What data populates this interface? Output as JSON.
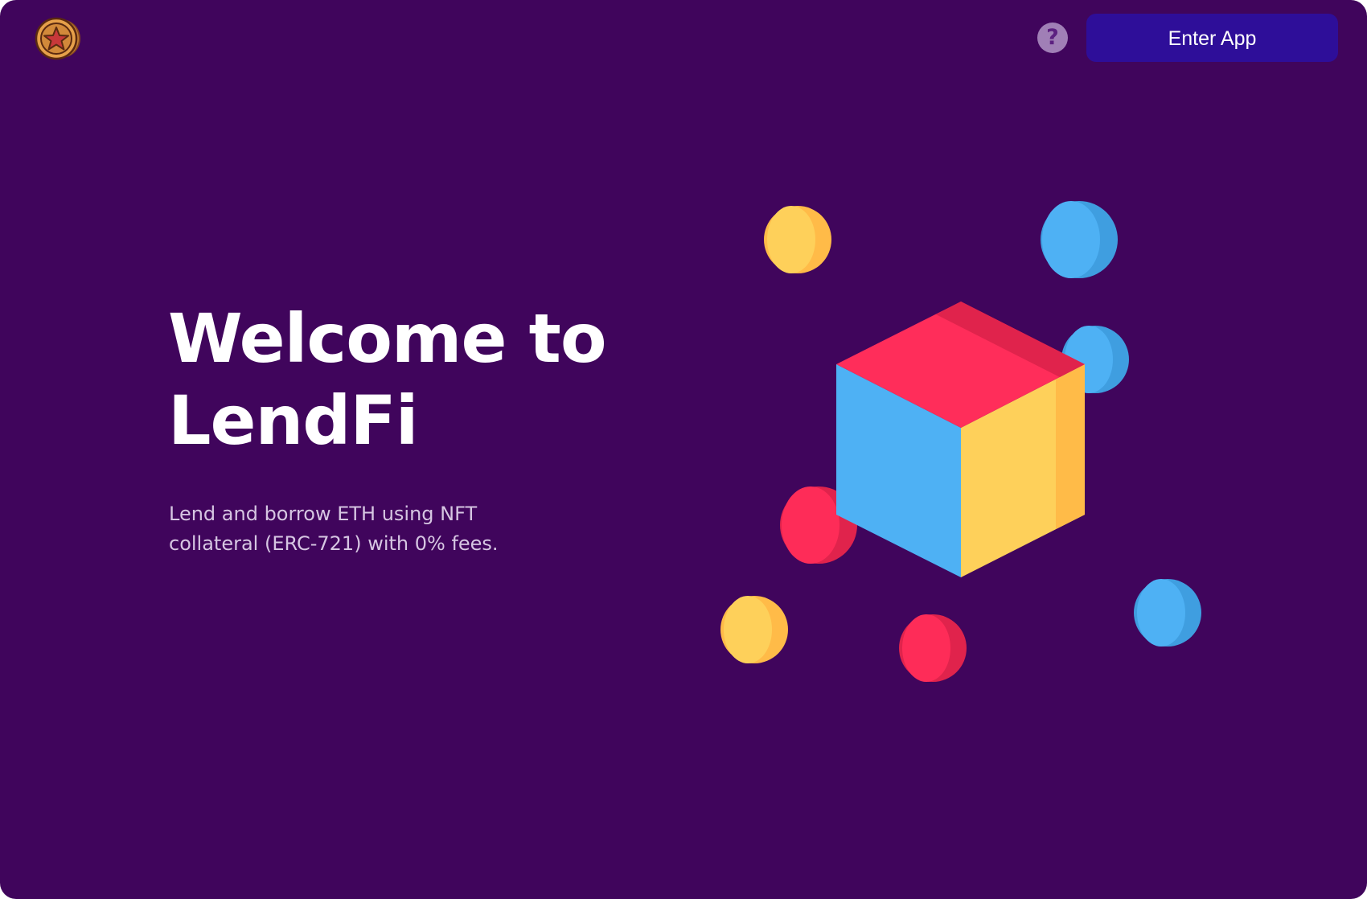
{
  "header": {
    "logo_icon": "star-coin-icon",
    "help_icon": "question-mark-icon",
    "help_glyph": "?",
    "enter_button_label": "Enter App"
  },
  "hero": {
    "title": "Welcome to LendFi",
    "subtitle": "Lend and borrow ETH using NFT collateral (ERC-721) with 0% fees."
  },
  "illustration": {
    "icon": "cube-with-spheres-icon"
  },
  "colors": {
    "background": "#40055c",
    "button": "#2e0e99",
    "cube_top": "#ff2d5a",
    "cube_left": "#4eb1f4",
    "cube_right": "#fed05a",
    "sphere_yellow": "#fed05a",
    "sphere_blue": "#4eb1f4",
    "sphere_red": "#fe2c58"
  }
}
